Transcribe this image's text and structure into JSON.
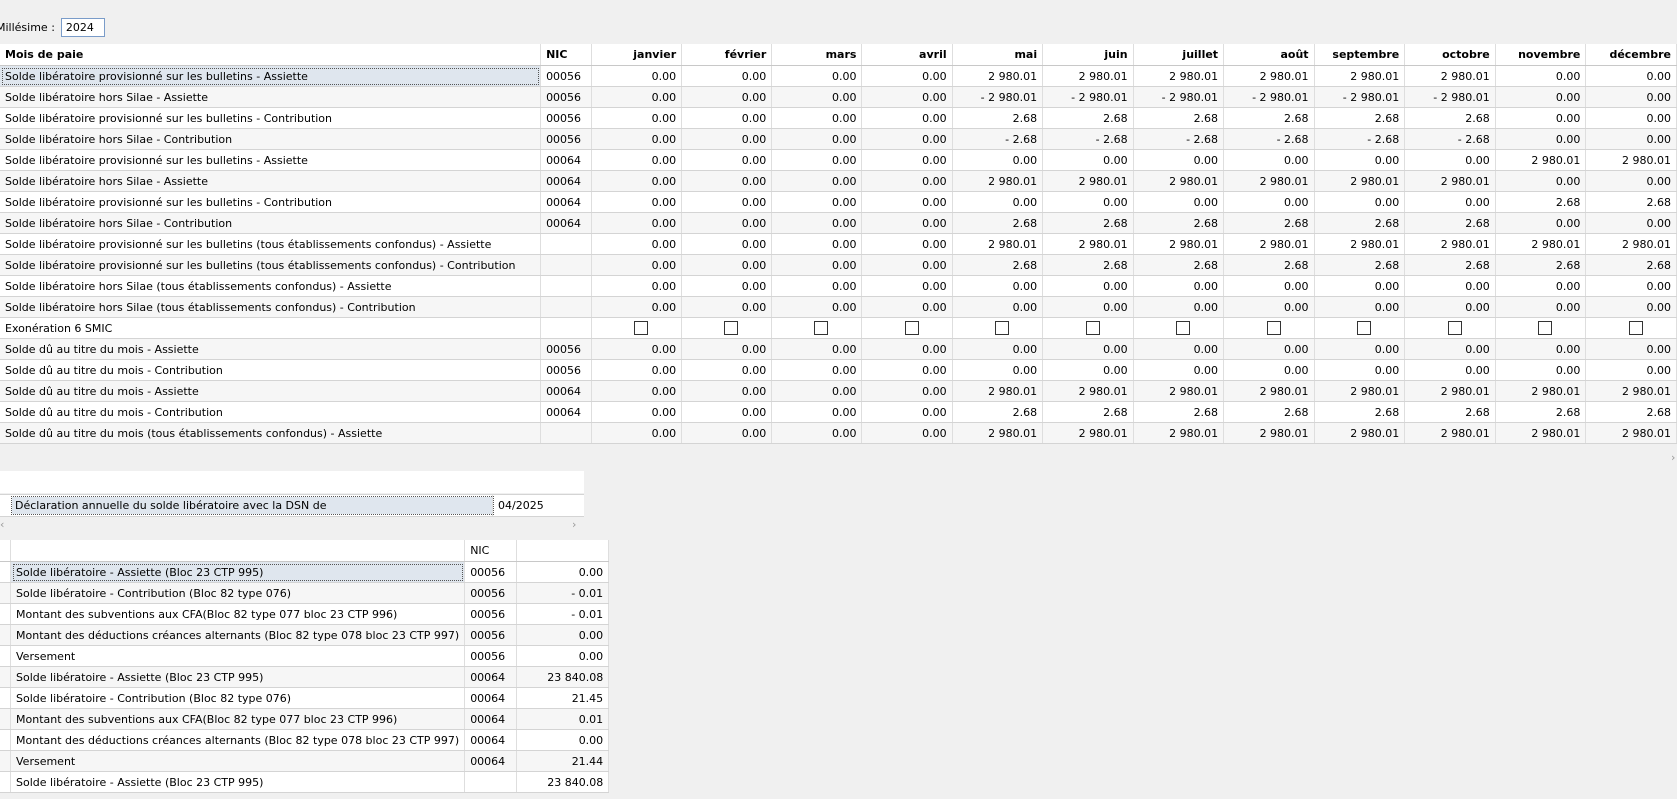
{
  "millesime": {
    "label": "Millésime :",
    "value": "2024"
  },
  "grid": {
    "headers": [
      "Mois de paie",
      "NIC",
      "janvier",
      "février",
      "mars",
      "avril",
      "mai",
      "juin",
      "juillet",
      "août",
      "septembre",
      "octobre",
      "novembre",
      "décembre"
    ],
    "rows": [
      {
        "label": "Solde libératoire provisionné sur les bulletins - Assiette",
        "nic": "00056",
        "values": [
          "0.00",
          "0.00",
          "0.00",
          "0.00",
          "2 980.01",
          "2 980.01",
          "2 980.01",
          "2 980.01",
          "2 980.01",
          "2 980.01",
          "0.00",
          "0.00"
        ]
      },
      {
        "label": "Solde libératoire hors Silae - Assiette",
        "nic": "00056",
        "values": [
          "0.00",
          "0.00",
          "0.00",
          "0.00",
          "- 2 980.01",
          "- 2 980.01",
          "- 2 980.01",
          "- 2 980.01",
          "- 2 980.01",
          "- 2 980.01",
          "0.00",
          "0.00"
        ]
      },
      {
        "label": "Solde libératoire provisionné sur les bulletins - Contribution",
        "nic": "00056",
        "values": [
          "0.00",
          "0.00",
          "0.00",
          "0.00",
          "2.68",
          "2.68",
          "2.68",
          "2.68",
          "2.68",
          "2.68",
          "0.00",
          "0.00"
        ]
      },
      {
        "label": "Solde libératoire hors Silae - Contribution",
        "nic": "00056",
        "values": [
          "0.00",
          "0.00",
          "0.00",
          "0.00",
          "- 2.68",
          "- 2.68",
          "- 2.68",
          "- 2.68",
          "- 2.68",
          "- 2.68",
          "0.00",
          "0.00"
        ]
      },
      {
        "label": "Solde libératoire provisionné sur les bulletins - Assiette",
        "nic": "00064",
        "values": [
          "0.00",
          "0.00",
          "0.00",
          "0.00",
          "0.00",
          "0.00",
          "0.00",
          "0.00",
          "0.00",
          "0.00",
          "2 980.01",
          "2 980.01"
        ]
      },
      {
        "label": "Solde libératoire hors Silae - Assiette",
        "nic": "00064",
        "values": [
          "0.00",
          "0.00",
          "0.00",
          "0.00",
          "2 980.01",
          "2 980.01",
          "2 980.01",
          "2 980.01",
          "2 980.01",
          "2 980.01",
          "0.00",
          "0.00"
        ]
      },
      {
        "label": "Solde libératoire provisionné sur les bulletins - Contribution",
        "nic": "00064",
        "values": [
          "0.00",
          "0.00",
          "0.00",
          "0.00",
          "0.00",
          "0.00",
          "0.00",
          "0.00",
          "0.00",
          "0.00",
          "2.68",
          "2.68"
        ]
      },
      {
        "label": "Solde libératoire hors Silae - Contribution",
        "nic": "00064",
        "values": [
          "0.00",
          "0.00",
          "0.00",
          "0.00",
          "2.68",
          "2.68",
          "2.68",
          "2.68",
          "2.68",
          "2.68",
          "0.00",
          "0.00"
        ]
      },
      {
        "label": "Solde libératoire provisionné sur les bulletins (tous établissements confondus) - Assiette",
        "nic": "",
        "values": [
          "0.00",
          "0.00",
          "0.00",
          "0.00",
          "2 980.01",
          "2 980.01",
          "2 980.01",
          "2 980.01",
          "2 980.01",
          "2 980.01",
          "2 980.01",
          "2 980.01"
        ]
      },
      {
        "label": "Solde libératoire provisionné sur les bulletins (tous établissements confondus) - Contribution",
        "nic": "",
        "values": [
          "0.00",
          "0.00",
          "0.00",
          "0.00",
          "2.68",
          "2.68",
          "2.68",
          "2.68",
          "2.68",
          "2.68",
          "2.68",
          "2.68"
        ]
      },
      {
        "label": "Solde libératoire hors Silae (tous établissements confondus) - Assiette",
        "nic": "",
        "values": [
          "0.00",
          "0.00",
          "0.00",
          "0.00",
          "0.00",
          "0.00",
          "0.00",
          "0.00",
          "0.00",
          "0.00",
          "0.00",
          "0.00"
        ]
      },
      {
        "label": "Solde libératoire hors Silae (tous établissements confondus) - Contribution",
        "nic": "",
        "values": [
          "0.00",
          "0.00",
          "0.00",
          "0.00",
          "0.00",
          "0.00",
          "0.00",
          "0.00",
          "0.00",
          "0.00",
          "0.00",
          "0.00"
        ]
      },
      {
        "label": "Exonération 6 SMIC",
        "nic": "",
        "checkbox": true,
        "values": []
      },
      {
        "label": "Solde dû au titre du mois - Assiette",
        "nic": "00056",
        "values": [
          "0.00",
          "0.00",
          "0.00",
          "0.00",
          "0.00",
          "0.00",
          "0.00",
          "0.00",
          "0.00",
          "0.00",
          "0.00",
          "0.00"
        ]
      },
      {
        "label": "Solde dû au titre du mois - Contribution",
        "nic": "00056",
        "values": [
          "0.00",
          "0.00",
          "0.00",
          "0.00",
          "0.00",
          "0.00",
          "0.00",
          "0.00",
          "0.00",
          "0.00",
          "0.00",
          "0.00"
        ]
      },
      {
        "label": "Solde dû au titre du mois - Assiette",
        "nic": "00064",
        "values": [
          "0.00",
          "0.00",
          "0.00",
          "0.00",
          "2 980.01",
          "2 980.01",
          "2 980.01",
          "2 980.01",
          "2 980.01",
          "2 980.01",
          "2 980.01",
          "2 980.01"
        ]
      },
      {
        "label": "Solde dû au titre du mois - Contribution",
        "nic": "00064",
        "values": [
          "0.00",
          "0.00",
          "0.00",
          "0.00",
          "2.68",
          "2.68",
          "2.68",
          "2.68",
          "2.68",
          "2.68",
          "2.68",
          "2.68"
        ]
      },
      {
        "label": "Solde dû au titre du mois (tous établissements confondus) - Assiette",
        "nic": "",
        "values": [
          "0.00",
          "0.00",
          "0.00",
          "0.00",
          "2 980.01",
          "2 980.01",
          "2 980.01",
          "2 980.01",
          "2 980.01",
          "2 980.01",
          "2 980.01",
          "2 980.01"
        ]
      }
    ]
  },
  "declaration": {
    "label": "Déclaration annuelle du solde libératoire avec la DSN de",
    "value": "04/2025"
  },
  "summary": {
    "headers": [
      "",
      "NIC",
      ""
    ],
    "rows": [
      {
        "label": "Solde libératoire - Assiette (Bloc 23 CTP 995)",
        "nic": "00056",
        "value": "0.00"
      },
      {
        "label": "Solde libératoire - Contribution (Bloc 82 type 076)",
        "nic": "00056",
        "value": "- 0.01"
      },
      {
        "label": "Montant des subventions aux CFA(Bloc 82 type 077 bloc 23 CTP 996)",
        "nic": "00056",
        "value": "- 0.01"
      },
      {
        "label": "Montant des déductions créances alternants (Bloc 82 type 078 bloc 23 CTP 997)",
        "nic": "00056",
        "value": "0.00"
      },
      {
        "label": "Versement",
        "nic": "00056",
        "value": "0.00"
      },
      {
        "label": "Solde libératoire - Assiette (Bloc 23 CTP 995)",
        "nic": "00064",
        "value": "23 840.08"
      },
      {
        "label": "Solde libératoire - Contribution (Bloc 82 type 076)",
        "nic": "00064",
        "value": "21.45"
      },
      {
        "label": "Montant des subventions aux CFA(Bloc 82 type 077 bloc 23 CTP 996)",
        "nic": "00064",
        "value": "0.01"
      },
      {
        "label": "Montant des déductions créances alternants (Bloc 82 type 078 bloc 23 CTP 997)",
        "nic": "00064",
        "value": "0.00"
      },
      {
        "label": "Versement",
        "nic": "00064",
        "value": "21.44"
      },
      {
        "label": "Solde libératoire - Assiette (Bloc 23 CTP 995)",
        "nic": "",
        "value": "23 840.08"
      }
    ]
  },
  "icons": {
    "scroll_right": "›",
    "scroll_left": "‹"
  }
}
